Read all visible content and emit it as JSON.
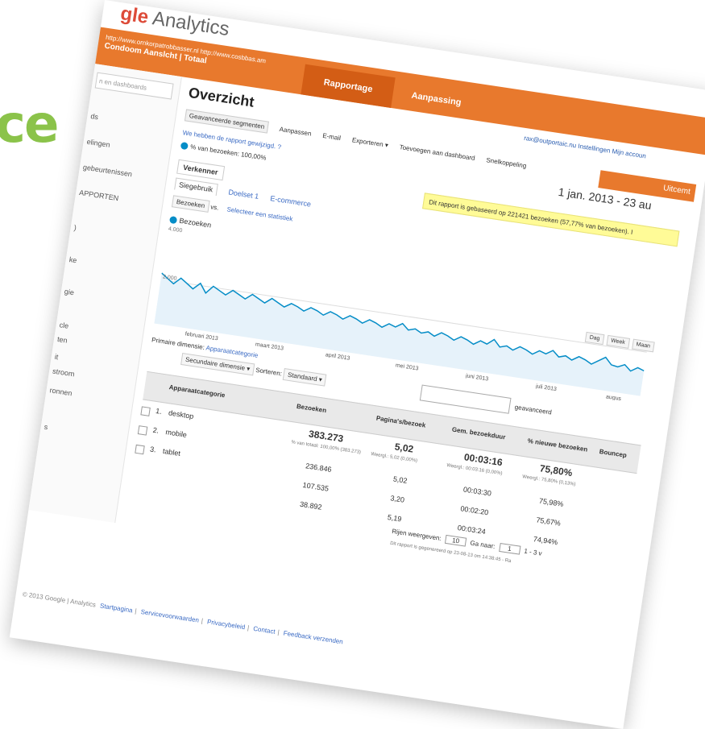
{
  "side_text": "ce",
  "logo": {
    "g": "gle",
    "name": "Analytics"
  },
  "account": {
    "line1": "http://www.ornkorpatrobbasser.nl  http://www.cosbbas.am",
    "line2": "Condoom Aanslcht | Totaal"
  },
  "tabs": {
    "reports": "Rapportage",
    "custom": "Aanpassing"
  },
  "sidebar": {
    "search": "n en dashboards",
    "items": [
      "ds",
      "elingen",
      "gebeurtenissen",
      "APPORTEN",
      ")",
      "ke",
      "gie",
      "cle",
      "ten",
      "it",
      "stroom",
      "ronnen",
      "s"
    ]
  },
  "page": {
    "title": "Overzicht",
    "user": "rax@outportaic.nu  Instellingen  Mijn accoun",
    "segments": [
      "Geavanceerde segmenten",
      "Aanpassen",
      "E-mail",
      "Exporteren ▾",
      "Toevoegen aan dashboard",
      "Snelkoppeling"
    ],
    "share": "Uitcemt",
    "date_range": "1 jan. 2013 - 23 au",
    "notice": "We hebben de rapport gewijzigd. ?",
    "visits_pct": "% van bezoeken: 100,00%",
    "sample": "Dit rapport is gebaseerd op 221421 bezoeken (57,77% van bezoeken). I",
    "subtab": "Verkenner",
    "content_tabs": [
      "Siegebruik",
      "Doelset 1",
      "E-commerce"
    ],
    "metric_select": "Bezoeken",
    "vs": "vs.",
    "select_metric": "Selecteer een statistiek",
    "legend": "Bezoeken",
    "y_top": "4.000",
    "y_mid": "2.000",
    "period": [
      "Dag",
      "Week",
      "Maan"
    ],
    "months": [
      "februari 2013",
      "maart 2013",
      "april 2013",
      "mei 2013",
      "juni 2013",
      "juli 2013",
      "augus"
    ],
    "primary_dim_label": "Primaire dimensie:",
    "primary_dim": "Apparaatcategorie",
    "secondary_dim": "Secundaire dimensie ▾",
    "sort_label": "Sorteren:",
    "sort_value": "Standaard ▾",
    "advanced": "geavanceerd"
  },
  "table": {
    "headers": [
      "Apparaatcategorie",
      "Bezoeken",
      "Pagina's/bezoek",
      "Gem. bezoekduur",
      "% nieuwe bezoeken",
      "Bouncep"
    ],
    "totals": {
      "visits": "383.273",
      "pages": "5,02",
      "duration": "00:03:16",
      "new": "75,80%"
    },
    "sub": {
      "visits": "% van totaal: 100,00% (383.273)",
      "pages": "Weergl.: 5,02 (0,00%)",
      "duration": "Weergl.: 00:03:16 (0,00%)",
      "new": "Weergl.: 75,80% (0,13%)"
    },
    "rows": [
      {
        "i": "1.",
        "label": "desktop",
        "visits": "236.846",
        "pages": "5,02",
        "duration": "00:03:30",
        "new": "75,98%"
      },
      {
        "i": "2.",
        "label": "mobile",
        "visits": "107.535",
        "pages": "3,20",
        "duration": "00:02:20",
        "new": "75,67%"
      },
      {
        "i": "3.",
        "label": "tablet",
        "visits": "38.892",
        "pages": "5,19",
        "duration": "00:03:24",
        "new": "74,94%"
      }
    ]
  },
  "pager": {
    "label": "Rijen weergeven:",
    "value": "10",
    "goto": "Ga naar:",
    "page": "1",
    "range": "1 - 3 v"
  },
  "generated": "Dit rapport is gegenereerd op 23-08-13 om 14:38:45 - Ra",
  "footer": {
    "copy": "© 2013 Google | Analytics",
    "links": [
      "Startpagina",
      "Servicevoorwaarden",
      "Privacybeleid",
      "Contact",
      "Feedback verzenden"
    ]
  },
  "chart_data": {
    "type": "area",
    "title": "",
    "series": [
      {
        "name": "Bezoeken",
        "values": [
          2300,
          2100,
          1900,
          2200,
          2000,
          1800,
          2100,
          1700,
          2050,
          1900,
          1750,
          2000,
          1850,
          1700,
          1950,
          1800,
          1650,
          1900,
          1750,
          1600,
          1800,
          1700,
          1550,
          1750,
          1650,
          1500,
          1700,
          1600,
          1450,
          1650,
          1550,
          1400,
          1600,
          1500,
          1350,
          1550,
          1450,
          1650,
          1400,
          1500,
          1350,
          1450,
          1300,
          1500,
          1400,
          1250,
          1450,
          1350,
          1200,
          1400,
          1300,
          1550,
          1250,
          1350,
          1200,
          1400,
          1300,
          1150,
          1350,
          1250,
          1450,
          1200,
          1300,
          1150,
          1350,
          1250,
          1100,
          1300,
          1500,
          1200,
          1150,
          1300,
          1050,
          1250,
          1150
        ]
      }
    ],
    "ylim": [
      0,
      4000
    ],
    "color": "#058dc7"
  }
}
